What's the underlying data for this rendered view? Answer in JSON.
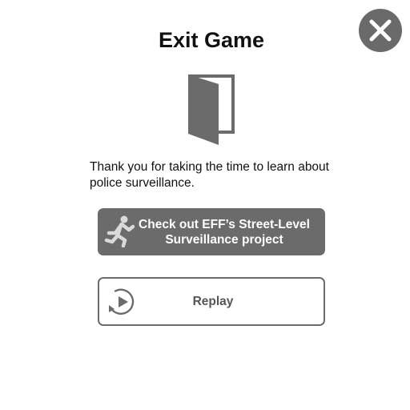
{
  "dialog": {
    "title": "Exit Game",
    "message": "Thank you for taking the time to learn about police surveillance."
  },
  "buttons": {
    "eff_project_label": "Check out EFF’s Street-Level Surveillance project",
    "replay_label": "Replay"
  },
  "icons": {
    "close": "close-icon",
    "door": "door-icon",
    "runner": "running-person-icon",
    "replay": "replay-icon"
  },
  "colors": {
    "button_fill": "#6b6b6b",
    "close_fill": "#6a6a6a",
    "text": "#111111"
  }
}
